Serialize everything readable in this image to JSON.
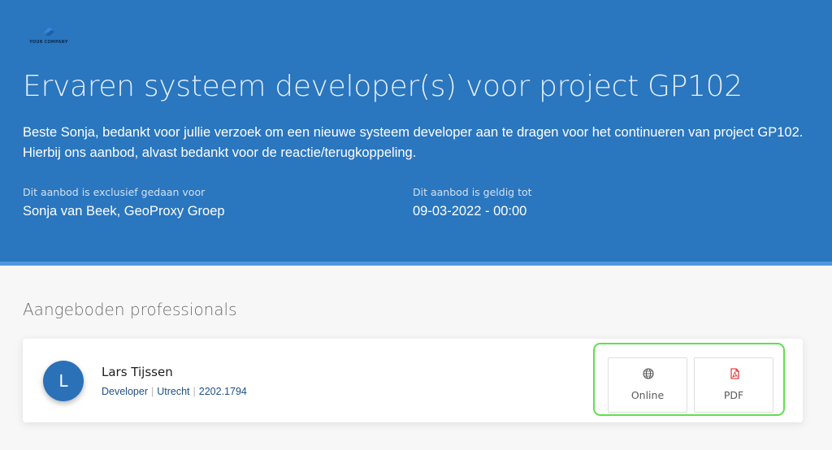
{
  "header": {
    "logo_text": "YOUR COMPANY",
    "title": "Ervaren systeem developer(s) voor project GP102",
    "intro": "Beste Sonja, bedankt voor jullie verzoek om een nieuwe systeem developer aan te dragen voor het continueren van project GP102. Hierbij ons aanbod, alvast bedankt voor de reactie/terugkoppeling.",
    "exclusive_label": "Dit aanbod is exclusief gedaan voor",
    "exclusive_value": "Sonja van Beek, GeoProxy Groep",
    "valid_label": "Dit aanbod is geldig tot",
    "valid_value": "09-03-2022 - 00:00"
  },
  "section": {
    "title": "Aangeboden professionals"
  },
  "professionals": [
    {
      "initial": "L",
      "name": "Lars Tijssen",
      "role": "Developer",
      "location": "Utrecht",
      "code": "2202.1794",
      "actions": [
        {
          "label": "Online",
          "icon": "globe-icon"
        },
        {
          "label": "PDF",
          "icon": "pdf-icon"
        }
      ]
    }
  ],
  "colors": {
    "hero_background": "#2a76bf",
    "accent_strip": "#4f97de",
    "avatar": "#2a71b8",
    "highlight_outline": "#5fe04c",
    "pdf_icon": "#e02020"
  }
}
